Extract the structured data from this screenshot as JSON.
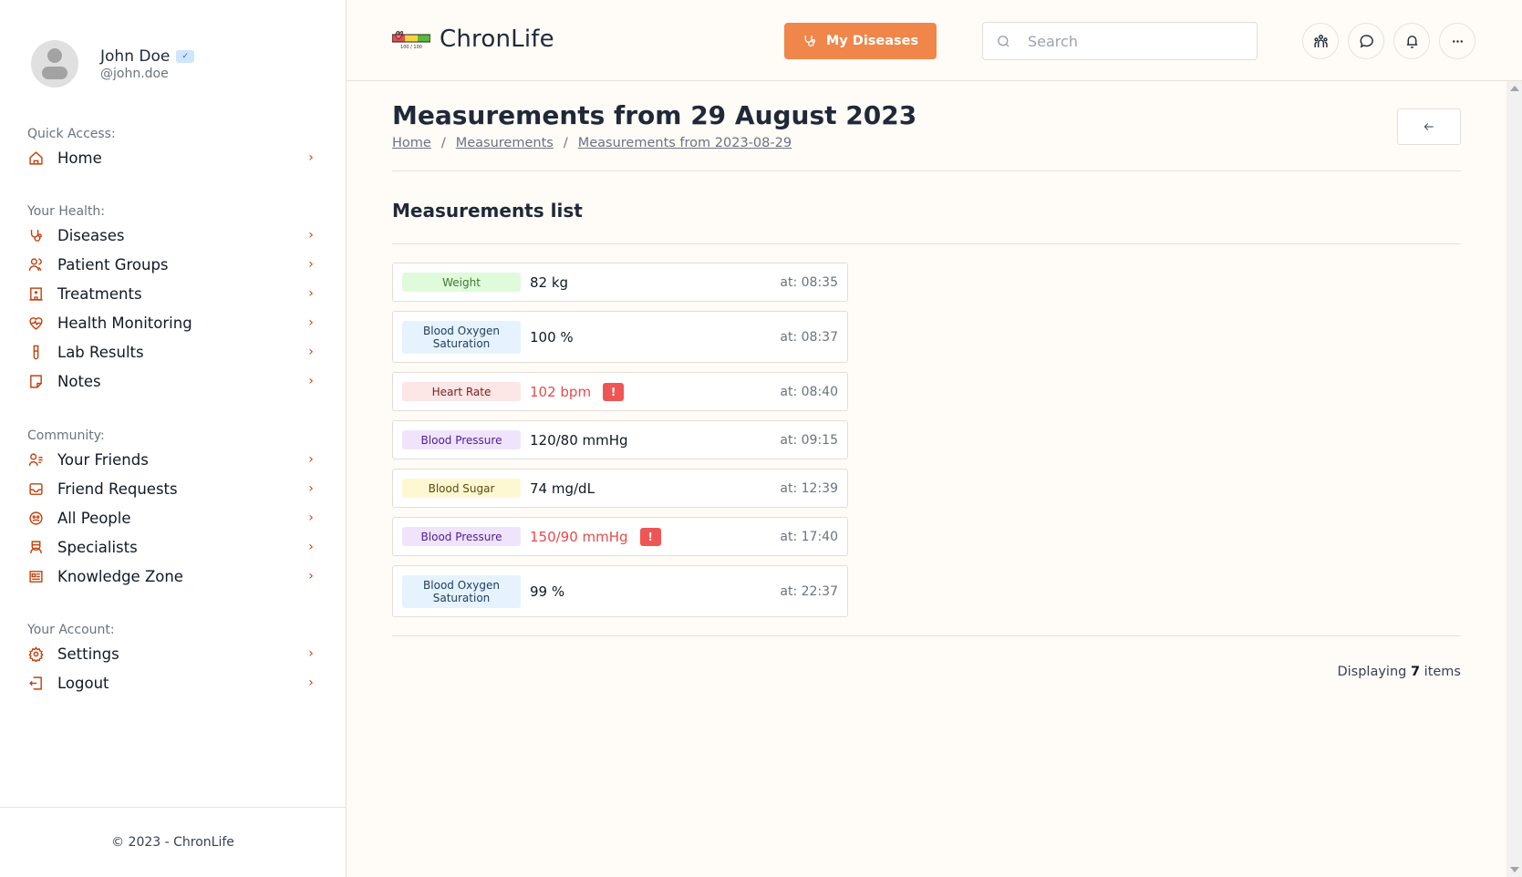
{
  "user": {
    "name": "John Doe",
    "handle": "@john.doe",
    "verified": true
  },
  "sidebar": {
    "sections": [
      {
        "heading": "Quick Access:",
        "items": [
          {
            "label": "Home",
            "icon": "home-icon"
          }
        ]
      },
      {
        "heading": "Your Health:",
        "items": [
          {
            "label": "Diseases",
            "icon": "stethoscope-icon"
          },
          {
            "label": "Patient Groups",
            "icon": "users-icon"
          },
          {
            "label": "Treatments",
            "icon": "hospital-icon"
          },
          {
            "label": "Health Monitoring",
            "icon": "heart-pulse-icon"
          },
          {
            "label": "Lab Results",
            "icon": "test-tube-icon"
          },
          {
            "label": "Notes",
            "icon": "note-icon"
          }
        ]
      },
      {
        "heading": "Community:",
        "items": [
          {
            "label": "Your Friends",
            "icon": "user-list-icon"
          },
          {
            "label": "Friend Requests",
            "icon": "inbox-icon"
          },
          {
            "label": "All People",
            "icon": "people-circle-icon"
          },
          {
            "label": "Specialists",
            "icon": "specialist-icon"
          },
          {
            "label": "Knowledge Zone",
            "icon": "newspaper-icon"
          }
        ]
      },
      {
        "heading": "Your Account:",
        "items": [
          {
            "label": "Settings",
            "icon": "gear-icon"
          },
          {
            "label": "Logout",
            "icon": "logout-icon"
          }
        ]
      }
    ],
    "footer": "© 2023 - ChronLife"
  },
  "header": {
    "brand": "ChronLife",
    "logo_caption": "100 / 100",
    "primary_button": "My Diseases",
    "search_placeholder": "Search",
    "search_value": ""
  },
  "page": {
    "title": "Measurements from 29 August 2023",
    "breadcrumb": [
      "Home",
      "Measurements",
      "Measurements from 2023-08-29"
    ],
    "section_title": "Measurements list",
    "count_prefix": "Displaying",
    "count": "7",
    "count_suffix": "items"
  },
  "measurements": [
    {
      "type": "Weight",
      "value": "82 kg",
      "time": "at: 08:35",
      "alert": false,
      "kind": "weight"
    },
    {
      "type": "Blood Oxygen Saturation",
      "value": "100 %",
      "time": "at: 08:37",
      "alert": false,
      "kind": "oxygen"
    },
    {
      "type": "Heart Rate",
      "value": "102 bpm",
      "time": "at: 08:40",
      "alert": true,
      "kind": "heart"
    },
    {
      "type": "Blood Pressure",
      "value": "120/80 mmHg",
      "time": "at: 09:15",
      "alert": false,
      "kind": "pressure"
    },
    {
      "type": "Blood Sugar",
      "value": "74 mg/dL",
      "time": "at: 12:39",
      "alert": false,
      "kind": "sugar"
    },
    {
      "type": "Blood Pressure",
      "value": "150/90 mmHg",
      "time": "at: 17:40",
      "alert": true,
      "kind": "pressure"
    },
    {
      "type": "Blood Oxygen Saturation",
      "value": "99 %",
      "time": "at: 22:37",
      "alert": false,
      "kind": "oxygen"
    }
  ],
  "alert_mark": "!",
  "colors": {
    "accent": "#f0864a",
    "sidebar_icon": "#c2410c",
    "alert": "#ee5656",
    "background": "#fffbf7"
  }
}
